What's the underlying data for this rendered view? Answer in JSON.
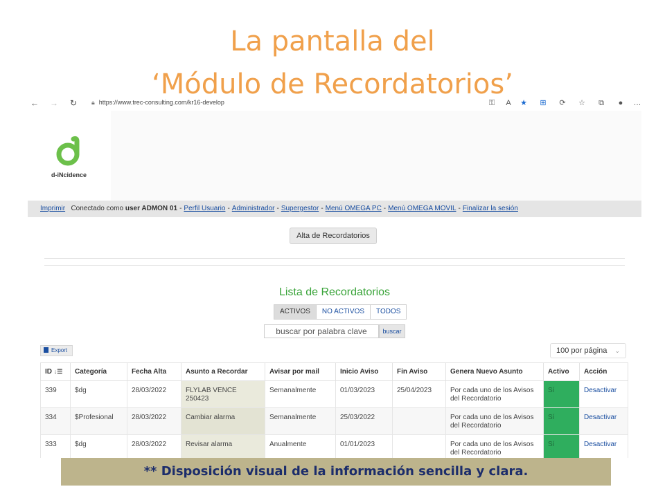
{
  "slide": {
    "title_line1": "La pantalla del",
    "title_line2": "‘Módulo de Recordatorios’",
    "banner": "** Disposición visual de la información sencilla y clara."
  },
  "browser": {
    "url_host": "https://www.trec-consulting.com",
    "url_path": "/kr16-develop"
  },
  "app": {
    "logo_text": "d-iNcidence",
    "menu": {
      "print": "Imprimir",
      "connected_as_prefix": "Conectado como",
      "user": "user ADMON 01",
      "links": [
        "Perfil Usuario",
        "Administrador",
        "Supergestor",
        "Menú OMEGA PC",
        "Menú OMEGA MOVIL",
        "Finalizar la sesión"
      ]
    },
    "alta_button": "Alta de Recordatorios",
    "list_title": "Lista de Recordatorios",
    "filters": [
      "ACTIVOS",
      "NO ACTIVOS",
      "TODOS"
    ],
    "search_placeholder": "buscar por palabra clave",
    "search_button": "buscar",
    "export_button": "Export",
    "per_page": "100 por página",
    "table": {
      "headers": [
        "ID",
        "Categoría",
        "Fecha Alta",
        "Asunto a Recordar",
        "Avisar por mail",
        "Inicio Aviso",
        "Fin Aviso",
        "Genera Nuevo Asunto",
        "Activo",
        "Acción"
      ],
      "rows": [
        [
          "339",
          "$dg",
          "28/03/2022",
          "FLYLAB VENCE 250423",
          "Semanalmente",
          "01/03/2023",
          "25/04/2023",
          "Por cada uno de los Avisos del Recordatorio",
          "Sí",
          "Desactivar"
        ],
        [
          "334",
          "$Profesional",
          "28/03/2022",
          "Cambiar alarma",
          "Semanalmente",
          "25/03/2022",
          "",
          "Por cada uno de los Avisos del Recordatorio",
          "Sí",
          "Desactivar"
        ],
        [
          "333",
          "$dg",
          "28/03/2022",
          "Revisar alarma",
          "Anualmente",
          "01/01/2023",
          "",
          "Por cada uno de los Avisos del Recordatorio",
          "Sí",
          "Desactivar"
        ]
      ]
    }
  },
  "colors": {
    "title": "#f0a04b",
    "activo_cell": "#2fae5e",
    "banner_bg": "#bdb48c",
    "list_title": "#3aa43a"
  }
}
